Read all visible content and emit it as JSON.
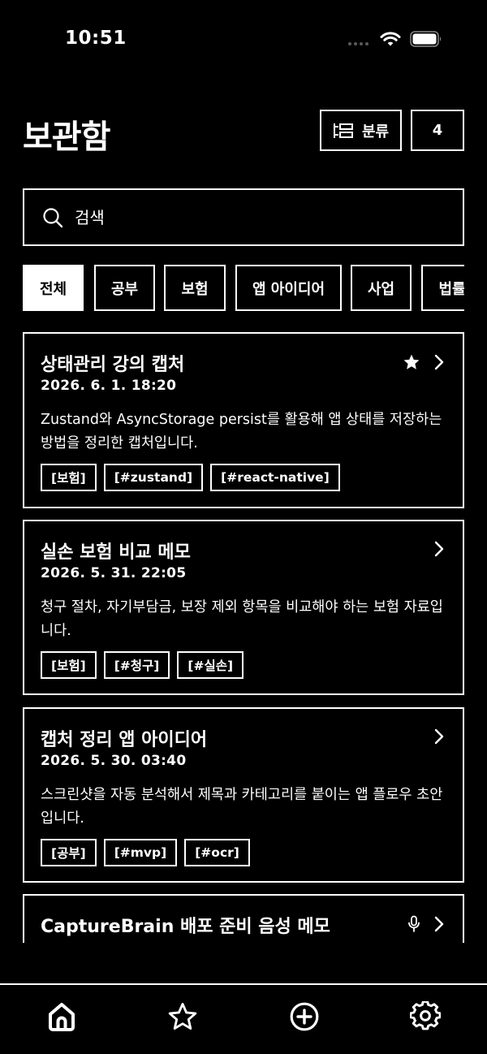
{
  "status_bar": {
    "time": "10:51",
    "icons": [
      "cellular-icon",
      "wifi-icon",
      "battery-icon"
    ]
  },
  "header": {
    "title": "보관함",
    "category_label": "분류",
    "count": "4"
  },
  "search": {
    "placeholder": "검색",
    "value": ""
  },
  "filters": [
    {
      "label": "전체",
      "active": true
    },
    {
      "label": "공부",
      "active": false
    },
    {
      "label": "보험",
      "active": false
    },
    {
      "label": "앱 아이디어",
      "active": false
    },
    {
      "label": "사업",
      "active": false
    },
    {
      "label": "법률",
      "active": false
    }
  ],
  "items": [
    {
      "title": "상태관리 강의 캡처",
      "date": "2026. 6. 1. 18:20",
      "body": "Zustand와 AsyncStorage persist를 활용해 앱 상태를 저장하는 방법을 정리한 캡처입니다.",
      "tags": [
        "[보험]",
        "[#zustand]",
        "[#react-native]"
      ],
      "starred": true,
      "voice": false
    },
    {
      "title": "실손 보험 비교 메모",
      "date": "2026. 5. 31. 22:05",
      "body": "청구 절차, 자기부담금, 보장 제외 항목을 비교해야 하는 보험 자료입니다.",
      "tags": [
        "[보험]",
        "[#청구]",
        "[#실손]"
      ],
      "starred": false,
      "voice": false
    },
    {
      "title": "캡처 정리 앱 아이디어",
      "date": "2026. 5. 30. 03:40",
      "body": "스크린샷을 자동 분석해서 제목과 카테고리를 붙이는 앱 플로우 초안입니다.",
      "tags": [
        "[공부]",
        "[#mvp]",
        "[#ocr]"
      ],
      "starred": false,
      "voice": false
    },
    {
      "title": "CaptureBrain 배포 준비 음성 메모",
      "date": "",
      "body": "",
      "tags": [],
      "starred": false,
      "voice": true
    }
  ],
  "nav": [
    {
      "icon": "home-icon",
      "active": true
    },
    {
      "icon": "star-icon",
      "active": false
    },
    {
      "icon": "add-icon",
      "active": false
    },
    {
      "icon": "settings-icon",
      "active": false
    }
  ],
  "colors": {
    "background": "#000000",
    "foreground": "#ffffff",
    "muted": "#5a5a5a"
  }
}
